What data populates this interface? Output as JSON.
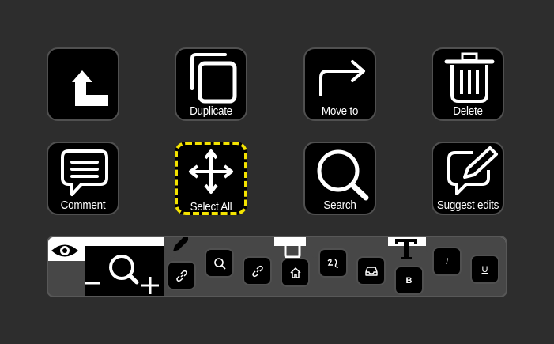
{
  "tiles": [
    {
      "id": "up",
      "label": "",
      "icon": "arrow-up-left-icon"
    },
    {
      "id": "duplicate",
      "label": "Duplicate",
      "icon": "duplicate-icon"
    },
    {
      "id": "move",
      "label": "Move to",
      "icon": "arrow-turn-right-icon"
    },
    {
      "id": "delete",
      "label": "Delete",
      "icon": "trash-icon"
    },
    {
      "id": "comment",
      "label": "Comment",
      "icon": "comment-icon"
    },
    {
      "id": "select_all",
      "label": "Select All",
      "icon": "move-arrows-icon"
    },
    {
      "id": "search",
      "label": "Search",
      "icon": "search-icon"
    },
    {
      "id": "suggest",
      "label": "Suggest edits",
      "icon": "edit-comment-icon"
    }
  ],
  "toolbar": {
    "bold_label": "B",
    "italic_label": "I",
    "underline_label": "U",
    "icons": [
      "eye-icon",
      "zoom-icon",
      "pencil-icon",
      "link-icon",
      "search-icon",
      "home-icon",
      "handwriting-icon",
      "inbox-icon",
      "square-icon",
      "text-icon"
    ]
  },
  "colors": {
    "background": "#2d2d2d",
    "tile": "#000000",
    "selection": "#f4e300",
    "toolbar": "#474747"
  }
}
